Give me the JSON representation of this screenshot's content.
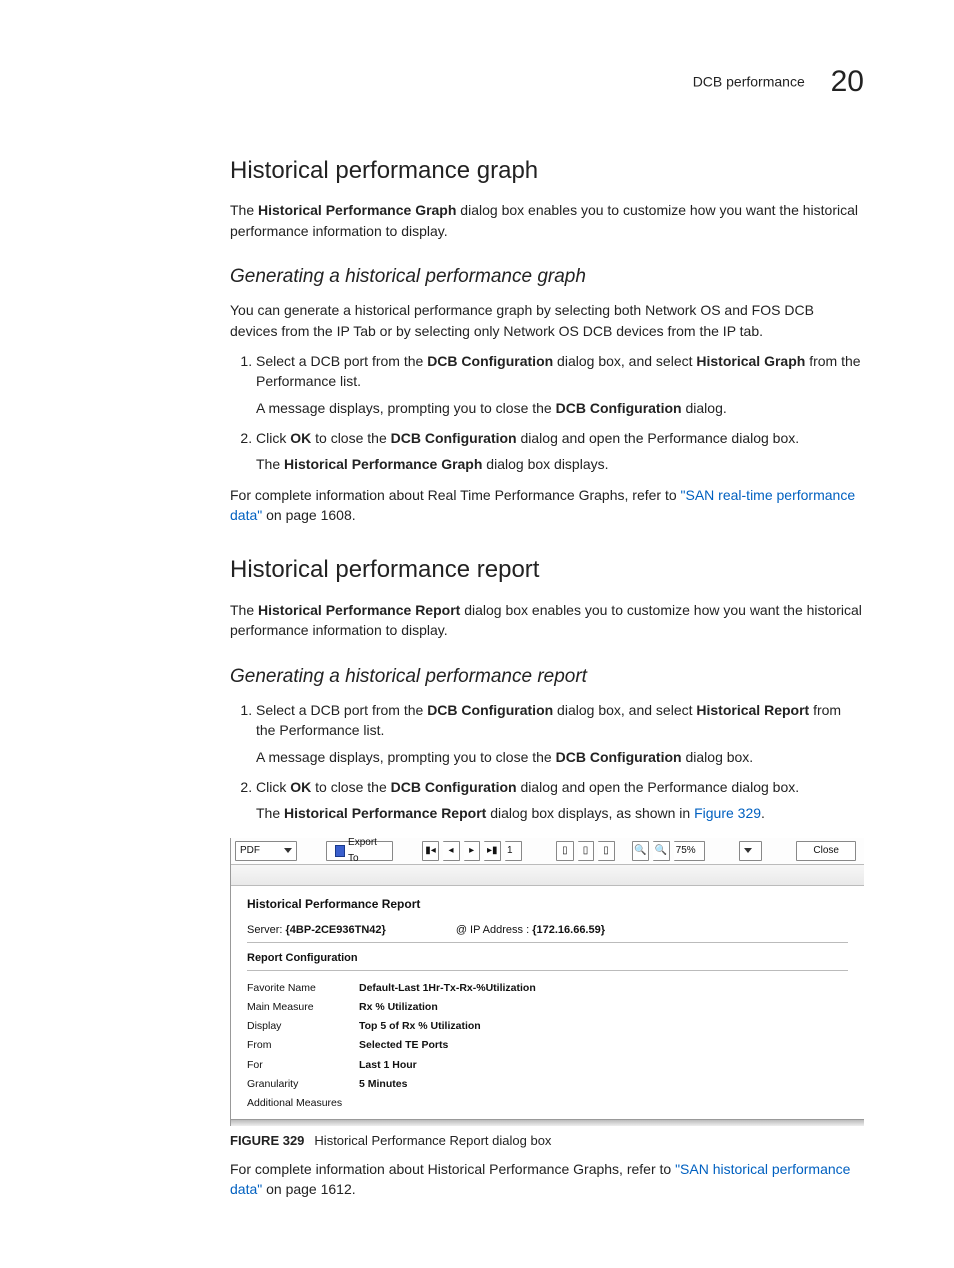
{
  "header": {
    "section": "DCB performance",
    "chapter": "20"
  },
  "sec1": {
    "title": "Historical performance graph",
    "intro_a": "The ",
    "intro_b": "Historical Performance Graph",
    "intro_c": " dialog box enables you to customize how you want the historical performance information to display.",
    "sub_title": "Generating a historical performance graph",
    "sub_intro": "You can generate a historical performance graph by selecting both Network OS and FOS DCB devices from the IP Tab or by selecting only Network OS DCB devices from the IP tab.",
    "step1_a": "Select a DCB port from the ",
    "step1_b": "DCB Configuration",
    "step1_c": " dialog box, and select ",
    "step1_d": "Historical Graph",
    "step1_e": " from the Performance list.",
    "step1_note_a": "A message displays, prompting you to close the ",
    "step1_note_b": "DCB Configuration",
    "step1_note_c": " dialog.",
    "step2_a": "Click ",
    "step2_b": "OK",
    "step2_c": " to close the ",
    "step2_d": "DCB Configuration",
    "step2_e": " dialog and open the Performance dialog box.",
    "step2_note_a": "The ",
    "step2_note_b": "Historical Performance Graph",
    "step2_note_c": " dialog box displays.",
    "ref_a": "For complete information about Real Time Performance Graphs, refer to ",
    "ref_link": "\"SAN real-time performance data\"",
    "ref_b": " on page 1608."
  },
  "sec2": {
    "title": "Historical performance report",
    "intro_a": "The ",
    "intro_b": "Historical Performance Report",
    "intro_c": " dialog box enables you to customize how you want the historical performance information to display.",
    "sub_title": "Generating a historical performance report",
    "step1_a": "Select a DCB port from the ",
    "step1_b": "DCB Configuration",
    "step1_c": " dialog box, and select ",
    "step1_d": "Historical Report",
    "step1_e": " from the Performance list.",
    "step1_note_a": "A message displays, prompting you to close the ",
    "step1_note_b": "DCB Configuration",
    "step1_note_c": " dialog box.",
    "step2_a": "Click ",
    "step2_b": "OK",
    "step2_c": " to close the ",
    "step2_d": "DCB Configuration",
    "step2_e": " dialog and open the Performance dialog box.",
    "step2_note_a": "The ",
    "step2_note_b": "Historical Performance Report",
    "step2_note_c": " dialog box displays, as shown in ",
    "step2_note_link": "Figure 329",
    "step2_note_d": ".",
    "ref_a": "For complete information about Historical Performance Graphs, refer to ",
    "ref_link": "\"SAN historical performance data\"",
    "ref_b": " on page 1612."
  },
  "figure": {
    "label": "FIGURE 329",
    "caption": "Historical Performance Report dialog box",
    "toolbar": {
      "format": "PDF",
      "export": "Export To",
      "page": "1",
      "zoom": "75%",
      "close": "Close"
    },
    "title": "Historical Performance Report",
    "server_label": "Server:",
    "server_val": "{4BP-2CE936TN42}",
    "ip_label": "@ IP Address :",
    "ip_val": "{172.16.66.59}",
    "config_title": "Report Configuration",
    "rows": [
      {
        "lab": "Favorite Name",
        "val": "Default-Last 1Hr-Tx-Rx-%Utilization"
      },
      {
        "lab": "Main Measure",
        "val": "Rx % Utilization"
      },
      {
        "lab": "Display",
        "val": "Top 5 of Rx % Utilization"
      },
      {
        "lab": "From",
        "val": "Selected  TE Ports"
      },
      {
        "lab": "For",
        "val": "Last 1 Hour"
      },
      {
        "lab": "Granularity",
        "val": "5 Minutes"
      },
      {
        "lab": "Additional Measures",
        "val": ""
      }
    ]
  }
}
